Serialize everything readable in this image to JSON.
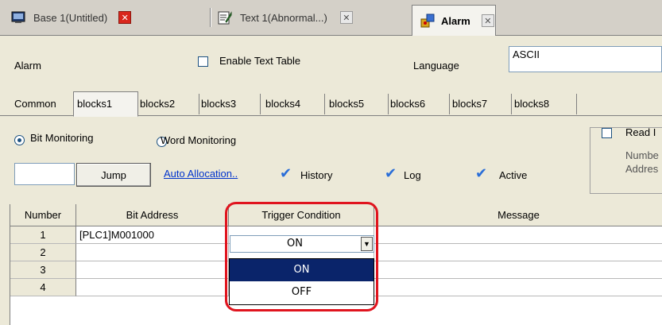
{
  "doc_tabs": [
    {
      "label": "Base 1(Untitled)",
      "icon": "screen-icon",
      "close": "close-icon-red"
    },
    {
      "label": "Text 1(Abnormal...)",
      "icon": "text-edit-icon",
      "close": "close-icon"
    },
    {
      "label": "Alarm",
      "icon": "alarm-icon",
      "close": "close-icon"
    }
  ],
  "header": {
    "section_label": "Alarm",
    "enable_text_table": "Enable Text Table",
    "language_label": "Language",
    "language_value": "ASCII"
  },
  "blocks_tabs": [
    "Common",
    "blocks1",
    "blocks2",
    "blocks3",
    "blocks4",
    "blocks5",
    "blocks6",
    "blocks7",
    "blocks8"
  ],
  "monitoring": {
    "bit": "Bit Monitoring",
    "word": "Word Monitoring",
    "selected": "Bit Monitoring"
  },
  "read_group": {
    "label": "Read I",
    "line1": "Numbe",
    "line2": "Addres"
  },
  "actions": {
    "jump": "Jump",
    "auto_allocation": "Auto Allocation..",
    "history": "History",
    "log": "Log",
    "active": "Active"
  },
  "grid": {
    "headers": [
      "Number",
      "Bit Address",
      "Trigger Condition",
      "Message"
    ],
    "rows": [
      {
        "number": "1",
        "bit_address": "[PLC1]M001000",
        "trigger": "ON"
      },
      {
        "number": "2",
        "bit_address": "",
        "trigger": ""
      },
      {
        "number": "3",
        "bit_address": "",
        "trigger": ""
      },
      {
        "number": "4",
        "bit_address": "",
        "trigger": ""
      }
    ]
  },
  "dropdown": {
    "selected": "ON",
    "options": [
      "ON",
      "OFF"
    ],
    "highlighted": "ON"
  },
  "colors": {
    "accent_highlight": "#e0141e",
    "selection": "#0a246a",
    "link": "#0033cc",
    "check": "#2a6ed8"
  }
}
